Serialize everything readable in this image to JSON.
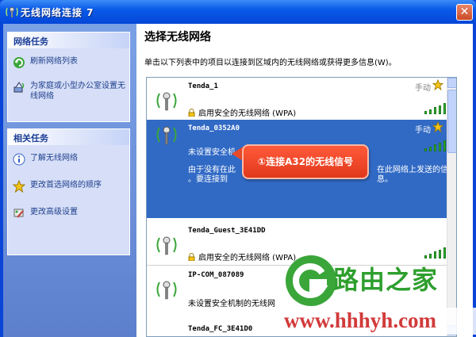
{
  "window": {
    "title": "无线网络连接 7",
    "close_glyph": "✕"
  },
  "left": {
    "network_tasks": {
      "header": "网络任务",
      "items": [
        "刷新网络列表",
        "为家庭或小型办公室设置无线网络"
      ]
    },
    "related_tasks": {
      "header": "相关任务",
      "items": [
        "了解无线网络",
        "更改首选网络的顺序",
        "更改高级设置"
      ]
    }
  },
  "main": {
    "title": "选择无线网络",
    "description": "单击以下列表中的项目以连接到区域内的无线网络或获得更多信息(W)。"
  },
  "networks": [
    {
      "name": "Tenda_1",
      "mode": "手动",
      "security": "启用安全的无线网络 (WPA)",
      "signal": 5
    },
    {
      "name": "Tenda_0352A0",
      "mode": "手动",
      "security": "未设置安全机",
      "detail1": "由于没有在此",
      "detail1_tail": "在此网络上发送的信",
      "detail1_end": "息。",
      "detail2": "。要连接到",
      "signal": 5,
      "selected": true
    },
    {
      "name": "Tenda_Guest_3E41DD",
      "security": "启用安全的无线网络 (WPA)",
      "signal": 5
    },
    {
      "name": "IP-COM_087089",
      "security": "未设置安全机制的无线网",
      "signal": 5
    },
    {
      "name": "Tenda_FC_3E41D0"
    }
  ],
  "callout": {
    "text": "①连接A32的无线信号"
  },
  "watermark": {
    "brand": "路由之家",
    "url": "www.hhhyh.com"
  },
  "icons": {
    "refresh": "refresh-icon",
    "setup": "wizard-icon",
    "info": "info-icon",
    "star": "star-icon",
    "settings": "settings-icon",
    "wireless": "wireless-antenna-icon",
    "lock": "lock-icon"
  },
  "colors": {
    "titlebar": "#0a5ae8",
    "selection": "#316ac5",
    "task_pane": "#6b8fd9",
    "callout": "#e0381c",
    "brand_green": "#2e9f2e"
  }
}
